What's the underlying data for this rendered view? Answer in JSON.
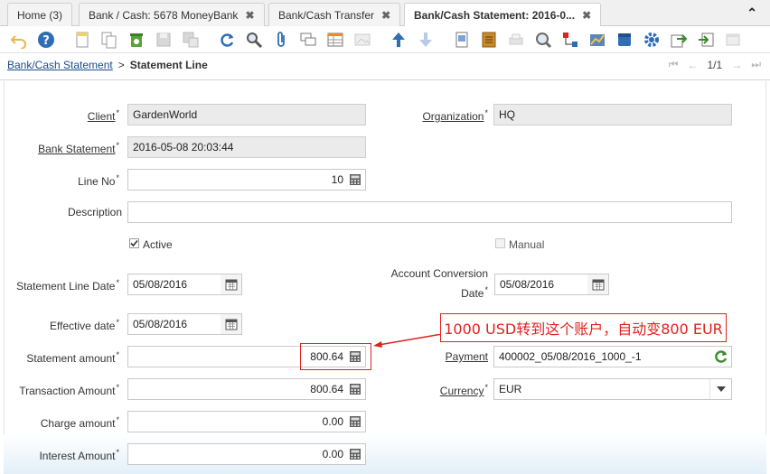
{
  "tabs": [
    {
      "label": "Home (3)",
      "closable": false
    },
    {
      "label": "Bank / Cash: 5678 MoneyBank",
      "closable": true
    },
    {
      "label": "Bank/Cash Transfer",
      "closable": true
    },
    {
      "label": "Bank/Cash Statement: 2016-0...",
      "closable": true,
      "active": true
    }
  ],
  "tab_close_glyph": "✖",
  "collapse_glyph": "⌃",
  "breadcrumb": {
    "parent": "Bank/Cash Statement",
    "separator": ">",
    "current": "Statement Line"
  },
  "pager": {
    "count": "1/1"
  },
  "required_mark": "*",
  "form": {
    "client": {
      "label": "Client",
      "value": "GardenWorld"
    },
    "organization": {
      "label": "Organization",
      "value": "HQ"
    },
    "bank_statement": {
      "label": "Bank Statement",
      "value": "2016-05-08 20:03:44"
    },
    "line_no": {
      "label": "Line No",
      "value": "10"
    },
    "description": {
      "label": "Description",
      "value": ""
    },
    "active": {
      "label": "Active",
      "checked": true
    },
    "manual": {
      "label": "Manual",
      "checked": false
    },
    "statement_line_date": {
      "label": "Statement Line Date",
      "value": "05/08/2016"
    },
    "account_conversion_date": {
      "label_line1": "Account Conversion",
      "label_line2": "Date",
      "value": "05/08/2016"
    },
    "effective_date": {
      "label": "Effective date",
      "value": "05/08/2016"
    },
    "statement_amount": {
      "label": "Statement amount",
      "value": "800.64"
    },
    "payment": {
      "label": "Payment",
      "value": "400002_05/08/2016_1000_-1"
    },
    "transaction_amount": {
      "label": "Transaction Amount",
      "value": "800.64"
    },
    "currency": {
      "label": "Currency",
      "value": "EUR"
    },
    "charge_amount": {
      "label": "Charge amount",
      "value": "0.00"
    },
    "interest_amount": {
      "label": "Interest Amount",
      "value": "0.00"
    }
  },
  "annotation": {
    "text": "1000 USD转到这个账户，自动变800 EUR",
    "color": "#e2211c"
  },
  "colors": {
    "link": "#1a4c8b",
    "readonly_bg": "#ebebeb",
    "accent_blue": "#2f6db5"
  }
}
